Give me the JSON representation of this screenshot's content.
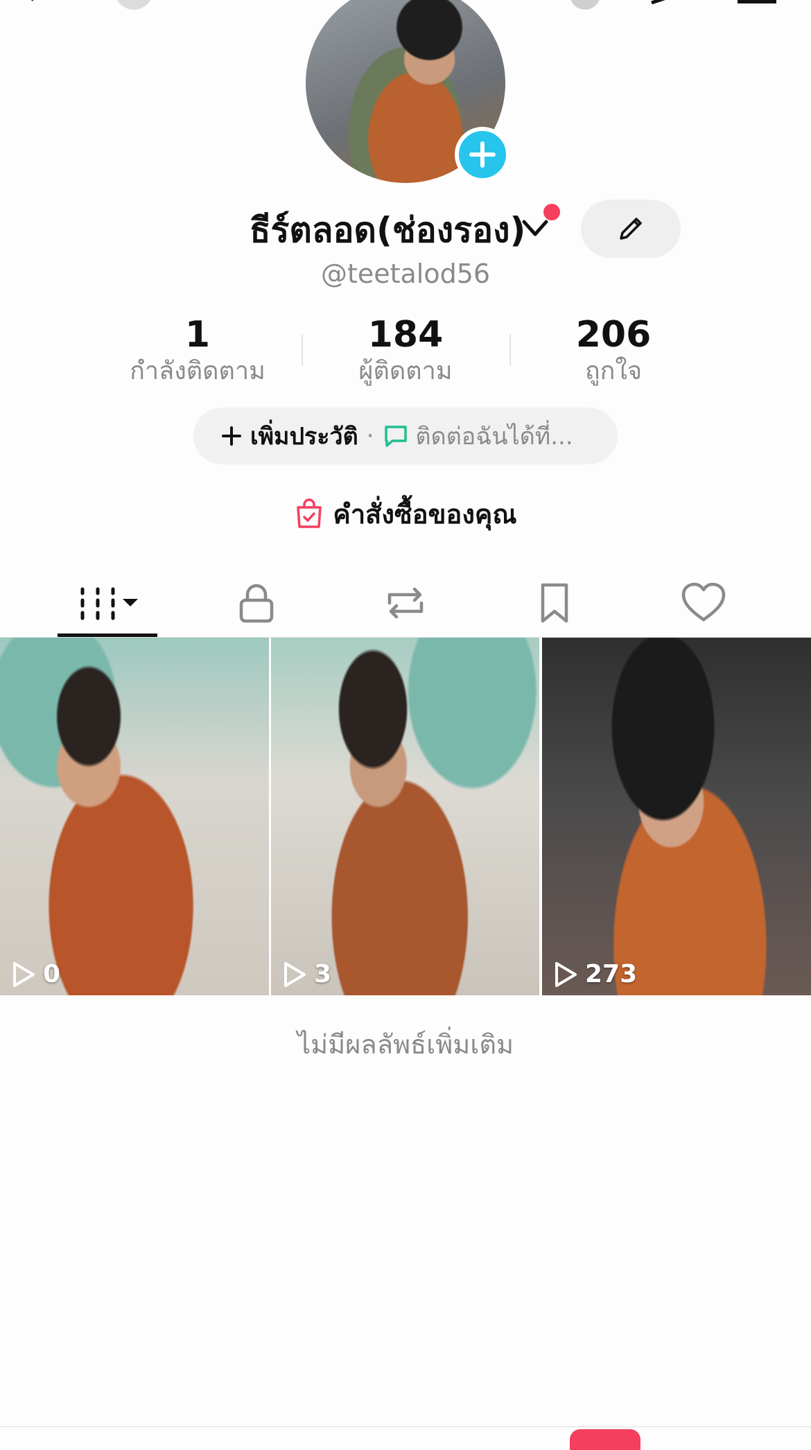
{
  "profile": {
    "display_name": "ธีร์ตลอด(ช่องรอง)",
    "handle": "@teetalod56"
  },
  "stats": [
    {
      "value": "1",
      "label": "กำลังติดตาม"
    },
    {
      "value": "184",
      "label": "ผู้ติดตาม"
    },
    {
      "value": "206",
      "label": "ถูกใจ"
    }
  ],
  "bio": {
    "add_label": "เพิ่มประวัติ",
    "separator": "·",
    "contact_label": "ติดต่อฉันได้ที่..."
  },
  "orders": {
    "label": "คำสั่งซื้อของคุณ"
  },
  "tabs": [
    "grid-icon",
    "lock-icon",
    "repost-icon",
    "bookmark-icon",
    "heart-icon"
  ],
  "videos": [
    {
      "views": "0"
    },
    {
      "views": "3"
    },
    {
      "views": "273"
    }
  ],
  "no_more_results": "ไม่มีผลลัพธ์เพิ่มเติม",
  "colors": {
    "accent_red": "#f43f5e",
    "plus_blue": "#27c5ec",
    "contact_green": "#1fbf8f"
  }
}
